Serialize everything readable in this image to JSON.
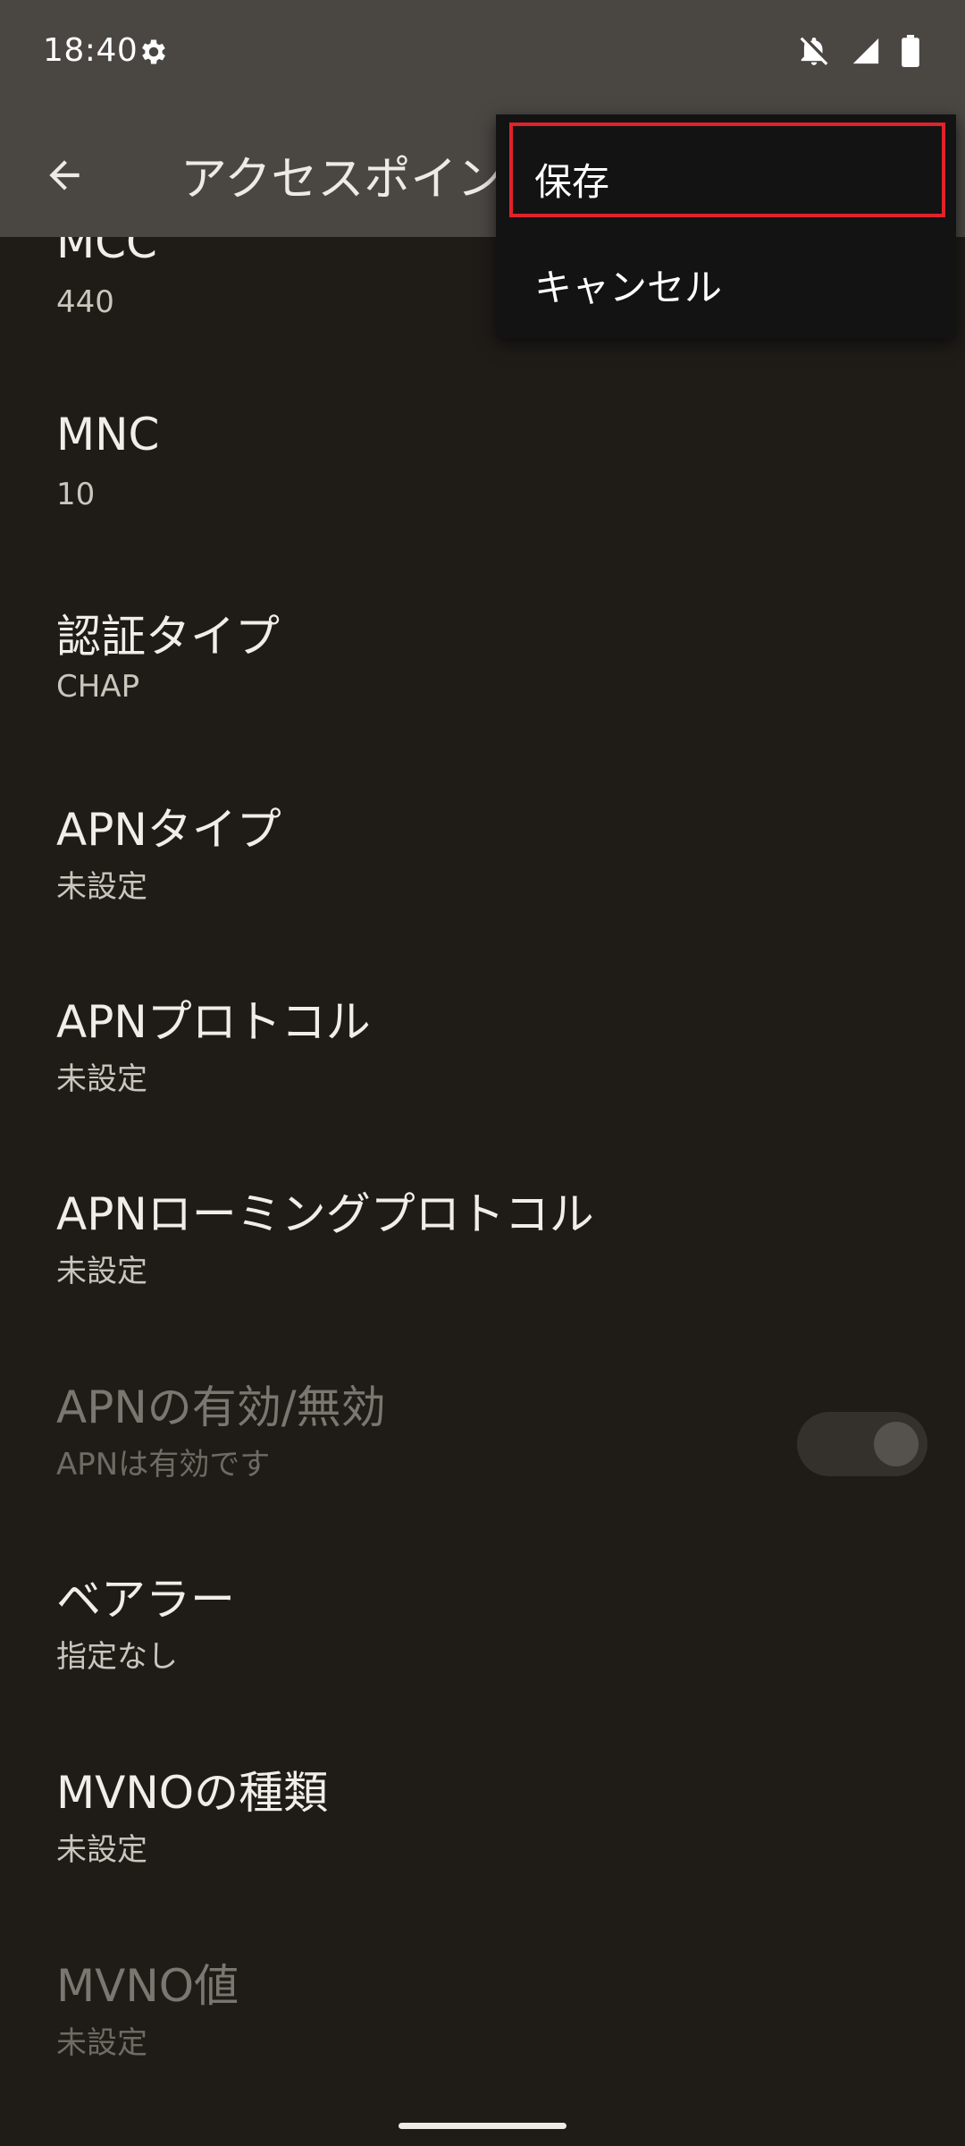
{
  "status_bar": {
    "time": "18:40",
    "icons": [
      "settings-gear-icon",
      "notifications-off-icon",
      "cell-signal-icon",
      "battery-icon"
    ]
  },
  "app_bar": {
    "back_icon": "arrow-back-icon",
    "title": "アクセスポイン"
  },
  "overflow_menu": {
    "items": [
      {
        "label": "保存"
      },
      {
        "label": "キャンセル"
      }
    ],
    "highlight_color": "#e0222b"
  },
  "preferences": [
    {
      "title": "MCC",
      "summary": "440"
    },
    {
      "title": "MNC",
      "summary": "10"
    },
    {
      "title": "認証タイプ",
      "summary": "CHAP"
    },
    {
      "title": "APNタイプ",
      "summary": "未設定"
    },
    {
      "title": "APNプロトコル",
      "summary": "未設定"
    },
    {
      "title": "APNローミングプロトコル",
      "summary": "未設定"
    },
    {
      "title": "APNの有効/無効",
      "summary": "APNは有効です"
    },
    {
      "title": "ベアラー",
      "summary": "指定なし"
    },
    {
      "title": "MVNOの種類",
      "summary": "未設定"
    },
    {
      "title": "MVNO値",
      "summary": "未設定"
    }
  ],
  "colors": {
    "background": "#1f1c18",
    "app_bar": "#4a4743",
    "menu_background": "#131313"
  }
}
